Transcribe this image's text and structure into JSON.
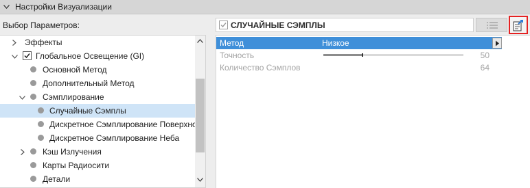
{
  "header": {
    "title": "Настройки Визуализации"
  },
  "left_panel": {
    "label": "Выбор Параметров:",
    "tree": [
      {
        "label": "Эффекты",
        "level": 0,
        "expander": "collapsed",
        "marker": "none",
        "selected": false
      },
      {
        "label": "Глобальное Освещение (GI)",
        "level": 0,
        "expander": "expanded",
        "marker": "checkbox-checked",
        "selected": false
      },
      {
        "label": "Основной Метод",
        "level": 1,
        "expander": "none",
        "marker": "dot",
        "selected": false
      },
      {
        "label": "Дополнительный Метод",
        "level": 1,
        "expander": "none",
        "marker": "dot",
        "selected": false
      },
      {
        "label": "Сэмплирование",
        "level": 1,
        "expander": "expanded",
        "marker": "dot",
        "selected": false
      },
      {
        "label": "Случайные Сэмплы",
        "level": 2,
        "expander": "none",
        "marker": "dot",
        "selected": true
      },
      {
        "label": "Дискретное Сэмплирование Поверхности",
        "level": 2,
        "expander": "none",
        "marker": "dot",
        "selected": false
      },
      {
        "label": "Дискретное Сэмплирование Неба",
        "level": 2,
        "expander": "none",
        "marker": "dot",
        "selected": false
      },
      {
        "label": "Кэш Излучения",
        "level": 1,
        "expander": "collapsed",
        "marker": "dot",
        "selected": false
      },
      {
        "label": "Карты Радиосити",
        "level": 1,
        "expander": "none",
        "marker": "dot",
        "selected": false
      },
      {
        "label": "Детали",
        "level": 1,
        "expander": "none",
        "marker": "dot",
        "selected": false
      }
    ]
  },
  "right_panel": {
    "section_title": "СЛУЧАЙНЫЕ СЭМПЛЫ",
    "rows": [
      {
        "name": "Метод",
        "value": "Низкое",
        "selected": true
      },
      {
        "name": "Точность",
        "value": "50",
        "level": 0.25,
        "selected": false
      },
      {
        "name": "Количество Сэмплов",
        "value": "64",
        "selected": false
      }
    ]
  },
  "colors": {
    "selected_row": "#3f8fd9",
    "tree_selection": "#cfe4f7",
    "highlight_border": "#e52222",
    "export_arrow": "#2e7dd7"
  }
}
